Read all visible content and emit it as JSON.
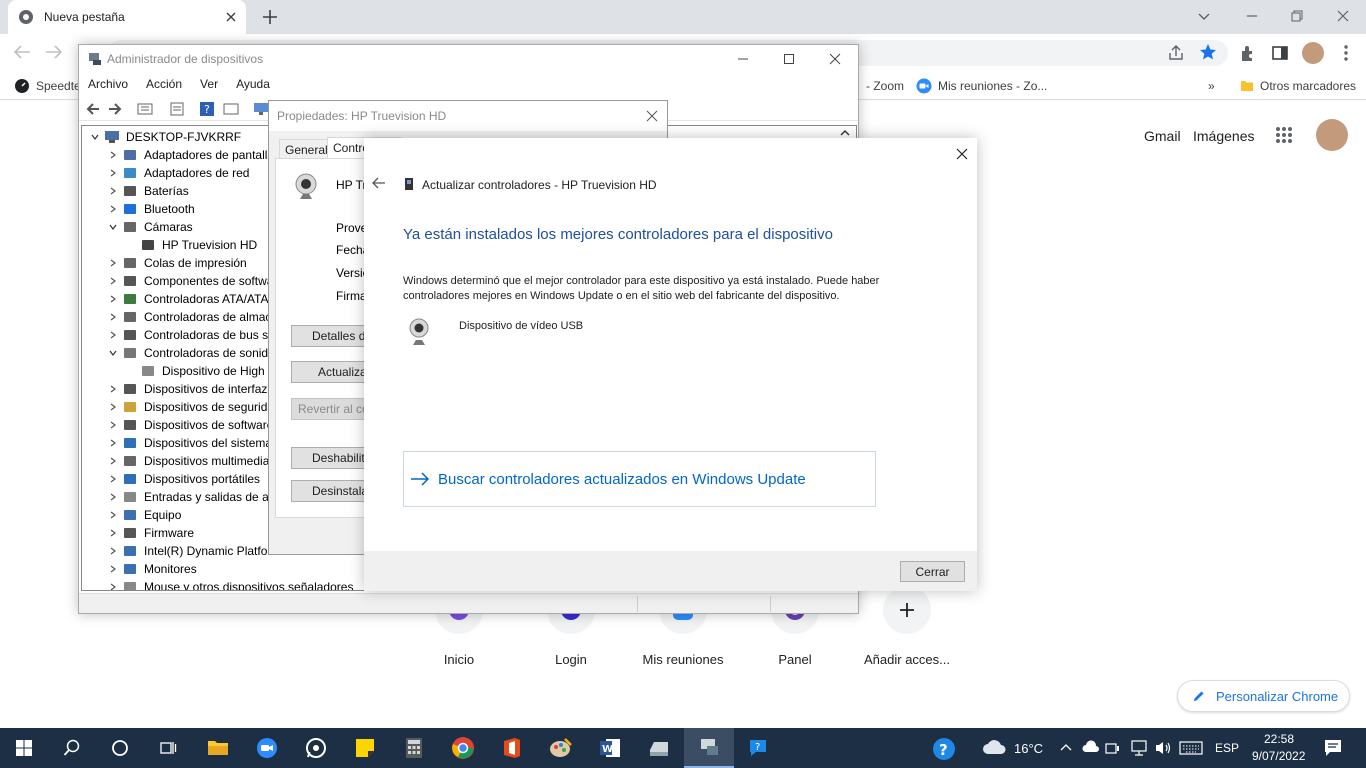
{
  "chrome": {
    "tab_title": "Nueva pestaña",
    "bookmarks": {
      "speedtest": "Speedte",
      "zoom": "- Zoom",
      "mis_reuniones": "Mis reuniones - Zo...",
      "more": "»",
      "otros": "Otros marcadores"
    }
  },
  "google": {
    "gmail": "Gmail",
    "imagenes": "Imágenes",
    "shortcuts": [
      "Inicio",
      "Login",
      "Mis reuniones",
      "Panel",
      "Añadir acces..."
    ],
    "customize": "Personalizar Chrome"
  },
  "devmgr": {
    "title": "Administrador de dispositivos",
    "menu": [
      "Archivo",
      "Acción",
      "Ver",
      "Ayuda"
    ],
    "tree": {
      "root": "DESKTOP-FJVKRRF",
      "items": [
        "Adaptadores de pantalla",
        "Adaptadores de red",
        "Baterías",
        "Bluetooth",
        "Cámaras",
        "HP Truevision HD",
        "Colas de impresión",
        "Componentes de software",
        "Controladoras ATA/ATAPI IDE",
        "Controladoras de almacenamiento",
        "Controladoras de bus serie universal",
        "Controladoras de sonido y vídeo y dispositivos de juego",
        "Dispositivo de High Definition Audio",
        "Dispositivos de interfaz humana",
        "Dispositivos de seguridad",
        "Dispositivos de software",
        "Dispositivos del sistema",
        "Dispositivos multimedia",
        "Dispositivos portátiles",
        "Entradas y salidas de audio",
        "Equipo",
        "Firmware",
        "Intel(R) Dynamic Platform and Thermal Framework",
        "Monitores",
        "Mouse y otros dispositivos señaladores"
      ]
    }
  },
  "props": {
    "title": "Propiedades: HP Truevision HD",
    "tabs": [
      "General",
      "Controlador"
    ],
    "device": "HP Tr",
    "labels": [
      "Prove",
      "Fecha",
      "Versió",
      "Firmar"
    ],
    "buttons": [
      "Detalles de",
      "Actualizar",
      "Revertir al cor",
      "Deshabilita",
      "Desinstalar"
    ]
  },
  "wizard": {
    "header": "Actualizar controladores - HP Truevision HD",
    "heading": "Ya están instalados los mejores controladores para el dispositivo",
    "body_line1": "Windows determinó que el mejor controlador para este dispositivo ya está instalado. Puede haber",
    "body_line2": "controladores mejores en Windows Update o en el sitio web del fabricante del dispositivo.",
    "device": "Dispositivo de vídeo USB",
    "update_link": "Buscar controladores actualizados en Windows Update",
    "close": "Cerrar"
  },
  "taskbar": {
    "temperature": "16°C",
    "lang": "ESP",
    "time": "22:58",
    "date": "9/07/2022"
  },
  "colors": {
    "accent_blue": "#1a73e8",
    "wizard_heading": "#1f4fa0",
    "link_blue": "#0066cc",
    "taskbar": "#1c2f45"
  }
}
